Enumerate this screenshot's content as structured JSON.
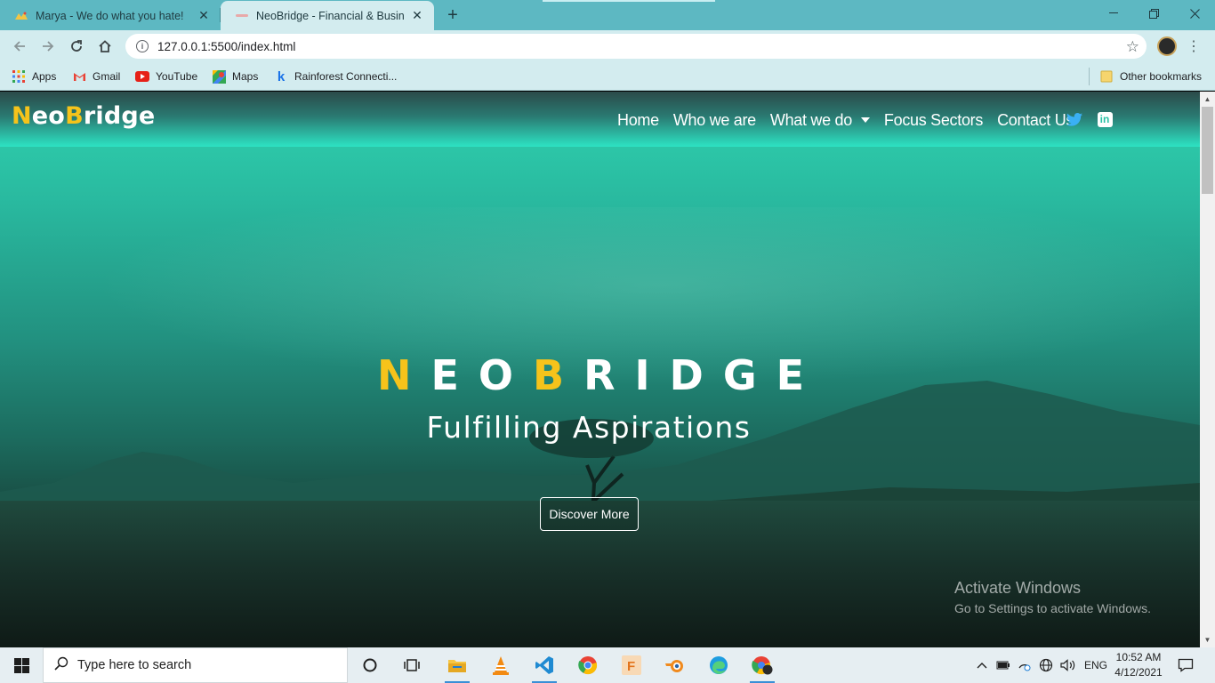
{
  "browser": {
    "tabs": [
      {
        "title": "Marya - We do what you hate!",
        "active": false
      },
      {
        "title": "NeoBridge - Financial & Business",
        "active": true
      }
    ],
    "new_tab_label": "+",
    "url": "127.0.0.1:5500/index.html",
    "bookmarks": [
      {
        "label": "Apps",
        "icon": "apps-grid-icon"
      },
      {
        "label": "Gmail",
        "icon": "gmail-icon"
      },
      {
        "label": "YouTube",
        "icon": "youtube-icon"
      },
      {
        "label": "Maps",
        "icon": "maps-icon"
      },
      {
        "label": "Rainforest Connecti...",
        "icon": "k-icon"
      }
    ],
    "other_bookmarks": "Other bookmarks"
  },
  "site": {
    "logo": {
      "first_letter": "N",
      "part1": "eo",
      "second_letter": "B",
      "part2": "ridge"
    },
    "nav": {
      "home": "Home",
      "who": "Who we are",
      "what": "What we do",
      "focus": "Focus Sectors",
      "contact": "Contact Us"
    },
    "social": {
      "twitter": "twitter-icon",
      "linkedin": "in"
    },
    "hero": {
      "brand_n": "N",
      "brand_eo": "EO",
      "brand_b": "B",
      "brand_ridge": "RIDGE",
      "tagline": "Fulfilling Aspirations",
      "cta": "Discover More"
    },
    "accent_color": "#f6c31b",
    "theme_color": "#2de3c3"
  },
  "watermark": {
    "line1": "Activate Windows",
    "line2": "Go to Settings to activate Windows."
  },
  "taskbar": {
    "search_placeholder": "Type here to search",
    "language": "ENG",
    "time": "10:52 AM",
    "date": "4/12/2021"
  }
}
